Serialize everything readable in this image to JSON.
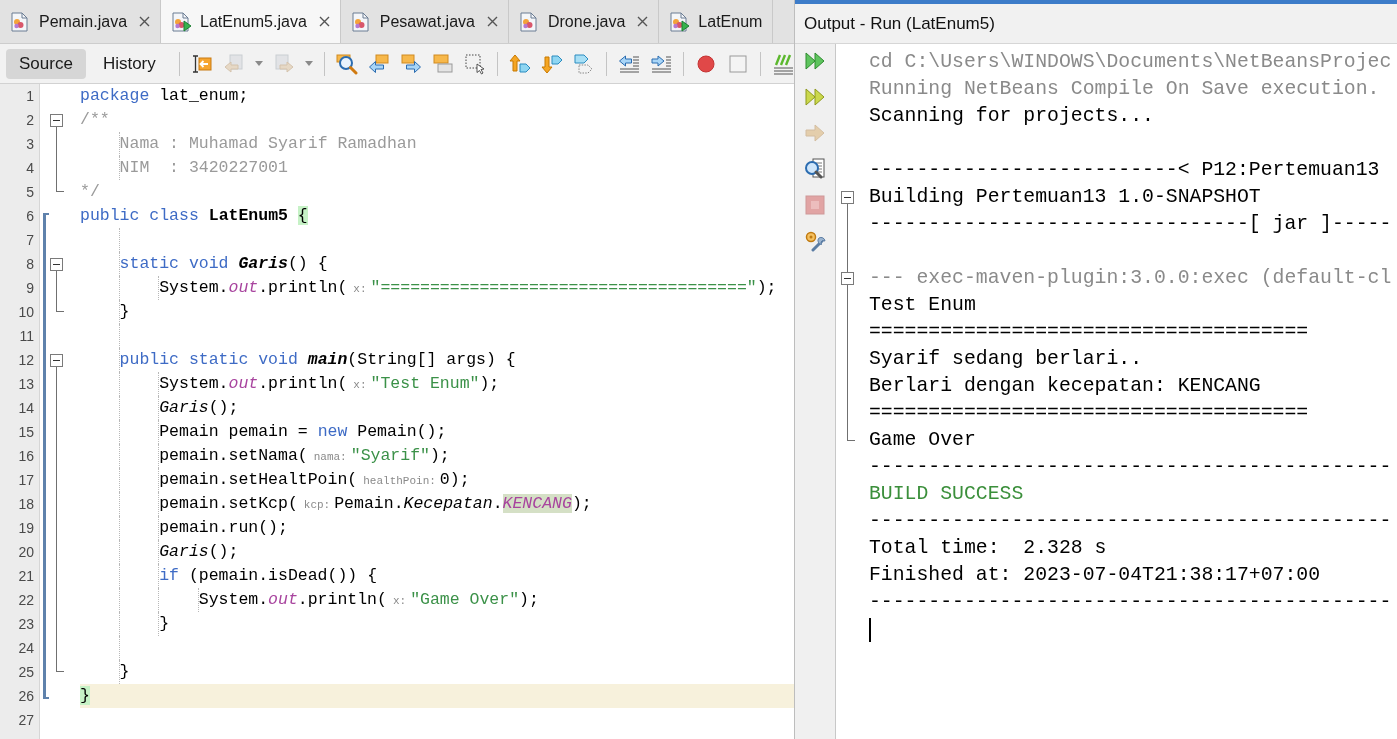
{
  "editor": {
    "tabs": [
      {
        "label": "Pemain.java",
        "kind": "class",
        "selected": false,
        "close": true
      },
      {
        "label": "LatEnum5.java",
        "kind": "main-class",
        "selected": true,
        "close": true
      },
      {
        "label": "Pesawat.java",
        "kind": "class",
        "selected": false,
        "close": true
      },
      {
        "label": "Drone.java",
        "kind": "class",
        "selected": false,
        "close": true
      },
      {
        "label": "LatEnum",
        "kind": "main-class",
        "selected": false,
        "close": false
      }
    ],
    "views": [
      {
        "label": "Source",
        "selected": true
      },
      {
        "label": "History",
        "selected": false
      }
    ],
    "toolbar": [
      [
        {
          "kind": "last-edit",
          "disabled": false,
          "dropdown": false
        },
        {
          "kind": "back",
          "disabled": true,
          "dropdown": true
        },
        {
          "kind": "forward",
          "disabled": true,
          "dropdown": true
        }
      ],
      [
        {
          "kind": "find",
          "disabled": false,
          "dropdown": false
        },
        {
          "kind": "find-previous",
          "disabled": false,
          "dropdown": false
        },
        {
          "kind": "find-next",
          "disabled": false,
          "dropdown": false
        },
        {
          "kind": "find-selection",
          "disabled": false,
          "dropdown": false
        },
        {
          "kind": "rect-select",
          "disabled": false,
          "dropdown": false
        }
      ],
      [
        {
          "kind": "bookmark-previous",
          "disabled": false,
          "dropdown": false
        },
        {
          "kind": "bookmark-next",
          "disabled": false,
          "dropdown": false
        },
        {
          "kind": "bookmark-toggle",
          "disabled": false,
          "dropdown": false
        }
      ],
      [
        {
          "kind": "shift-left",
          "disabled": false,
          "dropdown": false
        },
        {
          "kind": "shift-right",
          "disabled": false,
          "dropdown": false
        }
      ],
      [
        {
          "kind": "macro-record",
          "disabled": false,
          "dropdown": false
        },
        {
          "kind": "macro-stop",
          "disabled": false,
          "dropdown": false
        }
      ],
      [
        {
          "kind": "comment",
          "disabled": false,
          "dropdown": false
        }
      ]
    ],
    "lines": [
      {
        "number": "1",
        "current": false,
        "tokens": [
          {
            "text": "package",
            "kind": "keyword"
          },
          {
            "text": " lat_enum;",
            "kind": "plain"
          }
        ]
      },
      {
        "number": "2",
        "current": false,
        "expanded": true,
        "tokens": [
          {
            "text": "/**",
            "kind": "comment"
          }
        ],
        "children": [
          {
            "number": "3",
            "current": false,
            "tokens": [
              {
                "kind": "indent"
              },
              {
                "text": "Nama : Muhamad Syarif Ramadhan",
                "kind": "comment"
              }
            ]
          },
          {
            "number": "4",
            "current": false,
            "tokens": [
              {
                "kind": "indent"
              },
              {
                "text": "NIM  : 3420227001",
                "kind": "comment"
              }
            ]
          },
          {
            "number": "5",
            "current": false,
            "tokens": [
              {
                "text": "*/",
                "kind": "comment"
              }
            ]
          }
        ]
      },
      {
        "number": "6",
        "current": false,
        "active": true,
        "tokens": [
          {
            "text": "public class ",
            "kind": "keyword"
          },
          {
            "text": "LatEnum5 ",
            "kind": "class-decl"
          },
          {
            "text": "{",
            "kind": "matched-brace"
          }
        ],
        "children": [
          {
            "number": "7",
            "current": false,
            "tokens": [
              {
                "kind": "indent"
              }
            ]
          },
          {
            "number": "8",
            "current": false,
            "expanded": true,
            "tokens": [
              {
                "kind": "indent"
              },
              {
                "text": "static void ",
                "kind": "keyword"
              },
              {
                "text": "Garis",
                "kind": "method-decl"
              },
              {
                "text": "() {",
                "kind": "plain"
              }
            ],
            "children": [
              {
                "number": "9",
                "current": false,
                "tokens": [
                  {
                    "kind": "indent"
                  },
                  {
                    "kind": "indent"
                  },
                  {
                    "text": "System.",
                    "kind": "plain"
                  },
                  {
                    "text": "out",
                    "kind": "field"
                  },
                  {
                    "text": ".println(",
                    "kind": "plain"
                  },
                  {
                    "text": "x:",
                    "kind": "hint"
                  },
                  {
                    "text": "\"=====================================\"",
                    "kind": "string"
                  },
                  {
                    "text": ");",
                    "kind": "plain"
                  }
                ]
              },
              {
                "number": "10",
                "current": false,
                "tokens": [
                  {
                    "kind": "indent"
                  },
                  {
                    "text": "}",
                    "kind": "plain"
                  }
                ]
              }
            ]
          },
          {
            "number": "11",
            "current": false,
            "tokens": [
              {
                "kind": "indent"
              }
            ]
          },
          {
            "number": "12",
            "current": false,
            "expanded": true,
            "tokens": [
              {
                "kind": "indent"
              },
              {
                "text": "public static void ",
                "kind": "keyword"
              },
              {
                "text": "main",
                "kind": "method-decl"
              },
              {
                "text": "(String[] args) {",
                "kind": "plain"
              }
            ],
            "children": [
              {
                "number": "13",
                "current": false,
                "tokens": [
                  {
                    "kind": "indent"
                  },
                  {
                    "kind": "indent"
                  },
                  {
                    "text": "System.",
                    "kind": "plain"
                  },
                  {
                    "text": "out",
                    "kind": "field"
                  },
                  {
                    "text": ".println(",
                    "kind": "plain"
                  },
                  {
                    "text": "x:",
                    "kind": "hint"
                  },
                  {
                    "text": "\"Test Enum\"",
                    "kind": "string"
                  },
                  {
                    "text": ");",
                    "kind": "plain"
                  }
                ]
              },
              {
                "number": "14",
                "current": false,
                "tokens": [
                  {
                    "kind": "indent"
                  },
                  {
                    "kind": "indent"
                  },
                  {
                    "text": "Garis",
                    "kind": "static-call"
                  },
                  {
                    "text": "();",
                    "kind": "plain"
                  }
                ]
              },
              {
                "number": "15",
                "current": false,
                "tokens": [
                  {
                    "kind": "indent"
                  },
                  {
                    "kind": "indent"
                  },
                  {
                    "text": "Pemain pemain = ",
                    "kind": "plain"
                  },
                  {
                    "text": "new",
                    "kind": "keyword"
                  },
                  {
                    "text": " Pemain();",
                    "kind": "plain"
                  }
                ]
              },
              {
                "number": "16",
                "current": false,
                "tokens": [
                  {
                    "kind": "indent"
                  },
                  {
                    "kind": "indent"
                  },
                  {
                    "text": "pemain.setNama(",
                    "kind": "plain"
                  },
                  {
                    "text": "nama:",
                    "kind": "hint"
                  },
                  {
                    "text": "\"Syarif\"",
                    "kind": "string"
                  },
                  {
                    "text": ");",
                    "kind": "plain"
                  }
                ]
              },
              {
                "number": "17",
                "current": false,
                "tokens": [
                  {
                    "kind": "indent"
                  },
                  {
                    "kind": "indent"
                  },
                  {
                    "text": "pemain.setHealtPoin(",
                    "kind": "plain"
                  },
                  {
                    "text": "healthPoin:",
                    "kind": "hint"
                  },
                  {
                    "text": "0);",
                    "kind": "plain"
                  }
                ]
              },
              {
                "number": "18",
                "current": false,
                "tokens": [
                  {
                    "kind": "indent"
                  },
                  {
                    "kind": "indent"
                  },
                  {
                    "text": "pemain.setKcp(",
                    "kind": "plain"
                  },
                  {
                    "text": "kcp:",
                    "kind": "hint"
                  },
                  {
                    "text": "Pemain.",
                    "kind": "plain"
                  },
                  {
                    "text": "Kecepatan",
                    "kind": "static-ref"
                  },
                  {
                    "text": ".",
                    "kind": "plain"
                  },
                  {
                    "text": "KENCANG",
                    "kind": "marked-constant"
                  },
                  {
                    "text": ");",
                    "kind": "plain"
                  }
                ]
              },
              {
                "number": "19",
                "current": false,
                "tokens": [
                  {
                    "kind": "indent"
                  },
                  {
                    "kind": "indent"
                  },
                  {
                    "text": "pemain.run();",
                    "kind": "plain"
                  }
                ]
              },
              {
                "number": "20",
                "current": false,
                "tokens": [
                  {
                    "kind": "indent"
                  },
                  {
                    "kind": "indent"
                  },
                  {
                    "text": "Garis",
                    "kind": "static-call"
                  },
                  {
                    "text": "();",
                    "kind": "plain"
                  }
                ]
              },
              {
                "number": "21",
                "current": false,
                "tokens": [
                  {
                    "kind": "indent"
                  },
                  {
                    "kind": "indent"
                  },
                  {
                    "text": "if",
                    "kind": "keyword"
                  },
                  {
                    "text": " (pemain.isDead()) {",
                    "kind": "plain"
                  }
                ]
              },
              {
                "number": "22",
                "current": false,
                "tokens": [
                  {
                    "kind": "indent"
                  },
                  {
                    "kind": "indent"
                  },
                  {
                    "kind": "indent"
                  },
                  {
                    "text": "System.",
                    "kind": "plain"
                  },
                  {
                    "text": "out",
                    "kind": "field"
                  },
                  {
                    "text": ".println(",
                    "kind": "plain"
                  },
                  {
                    "text": "x:",
                    "kind": "hint"
                  },
                  {
                    "text": "\"Game Over\"",
                    "kind": "string"
                  },
                  {
                    "text": ");",
                    "kind": "plain"
                  }
                ]
              },
              {
                "number": "23",
                "current": false,
                "tokens": [
                  {
                    "kind": "indent"
                  },
                  {
                    "kind": "indent"
                  },
                  {
                    "text": "}",
                    "kind": "plain"
                  }
                ]
              },
              {
                "number": "24",
                "current": false,
                "tokens": [
                  {
                    "kind": "indent"
                  }
                ]
              },
              {
                "number": "25",
                "current": false,
                "tokens": [
                  {
                    "kind": "indent"
                  },
                  {
                    "text": "}",
                    "kind": "plain"
                  }
                ]
              }
            ]
          },
          {
            "number": "26",
            "current": true,
            "tokens": [
              {
                "text": "}",
                "kind": "matched-brace"
              }
            ]
          }
        ]
      },
      {
        "number": "27",
        "current": false
      }
    ]
  },
  "output": {
    "title": "Output - Run (LatEnum5)",
    "active": true,
    "actions": [
      {
        "kind": "rerun",
        "disabled": false
      },
      {
        "kind": "rerun-params",
        "disabled": false
      },
      {
        "kind": "resume",
        "disabled": true
      },
      {
        "kind": "search",
        "disabled": false
      },
      {
        "kind": "stop",
        "disabled": true
      },
      {
        "kind": "settings",
        "disabled": false
      }
    ],
    "lines": [
      {
        "kind": "muted",
        "text": "cd C:\\Users\\WINDOWS\\Documents\\NetBeansProjec"
      },
      {
        "kind": "muted",
        "text": "Running NetBeans Compile On Save execution."
      },
      {
        "kind": "plain",
        "text": "Scanning for projects..."
      },
      {
        "kind": "blank"
      },
      {
        "kind": "plain",
        "text": "--------------------------< P12:Pertemuan13"
      },
      {
        "kind": "plain",
        "text": "Building Pertemuan13 1.0-SNAPSHOT",
        "expanded": true,
        "children": [
          {
            "kind": "plain",
            "text": "--------------------------------[ jar ]-----"
          },
          {
            "kind": "blank"
          },
          {
            "kind": "muted",
            "text": "--- exec-maven-plugin:3.0.0:exec (default-cl",
            "expanded": true,
            "children": [
              {
                "kind": "plain",
                "text": "Test Enum"
              },
              {
                "kind": "plain",
                "text": "====================================="
              },
              {
                "kind": "plain",
                "text": "Syarif sedang berlari.."
              },
              {
                "kind": "plain",
                "text": "Berlari dengan kecepatan: KENCANG"
              },
              {
                "kind": "plain",
                "text": "====================================="
              },
              {
                "kind": "plain",
                "text": "Game Over"
              }
            ]
          }
        ]
      },
      {
        "kind": "plain",
        "text": "--------------------------------------------"
      },
      {
        "kind": "success",
        "text": "BUILD SUCCESS"
      },
      {
        "kind": "plain",
        "text": "--------------------------------------------"
      },
      {
        "kind": "plain",
        "text": "Total time:  2.328 s"
      },
      {
        "kind": "plain",
        "text": "Finished at: 2023-07-04T21:38:17+07:00"
      },
      {
        "kind": "plain",
        "text": "--------------------------------------------"
      },
      {
        "kind": "caret"
      }
    ]
  }
}
